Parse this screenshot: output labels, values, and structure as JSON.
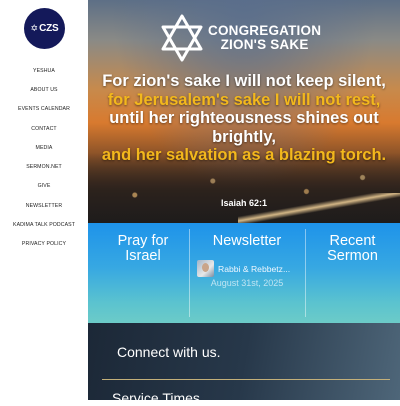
{
  "logo": {
    "letters": "CZS"
  },
  "nav": {
    "items": [
      {
        "label": "YESHUA"
      },
      {
        "label": "ABOUT US"
      },
      {
        "label": "EVENTS CALENDAR"
      },
      {
        "label": "CONTACT"
      },
      {
        "label": "MEDIA"
      },
      {
        "label": "SERMON.NET"
      },
      {
        "label": "GIVE"
      },
      {
        "label": "NEWSLETTER"
      },
      {
        "label": "KADIMA TALK PODCAST"
      },
      {
        "label": "PRIVACY POLICY"
      }
    ]
  },
  "hero": {
    "brand_line1": "CONGREGATION",
    "brand_line2": "ZION'S SAKE",
    "verse_line1": "For zion's sake I will not keep silent,",
    "verse_line2": "for Jerusalem's sake I will not rest,",
    "verse_line3": "until her righteousness shines out brightly,",
    "verse_line4": "and her salvation as a blazing torch.",
    "reference": "Isaiah 62:1"
  },
  "features": {
    "pray": "Pray for Israel",
    "newsletter": {
      "title": "Newsletter",
      "item_title": "Rabbi & Rebbetz...",
      "item_date": "August 31st, 2025"
    },
    "recent_sermon": "Recent Sermon"
  },
  "footer": {
    "connect": "Connect with us.",
    "service_times": "Service Times"
  },
  "colors": {
    "logo_bg": "#14195a",
    "verse_accent": "#f3b81c",
    "feature_band": "#1e93ea",
    "footer_bg": "#1c2837",
    "footer_rule": "#c3b07a"
  },
  "icons": [
    "star-of-david-icon"
  ]
}
